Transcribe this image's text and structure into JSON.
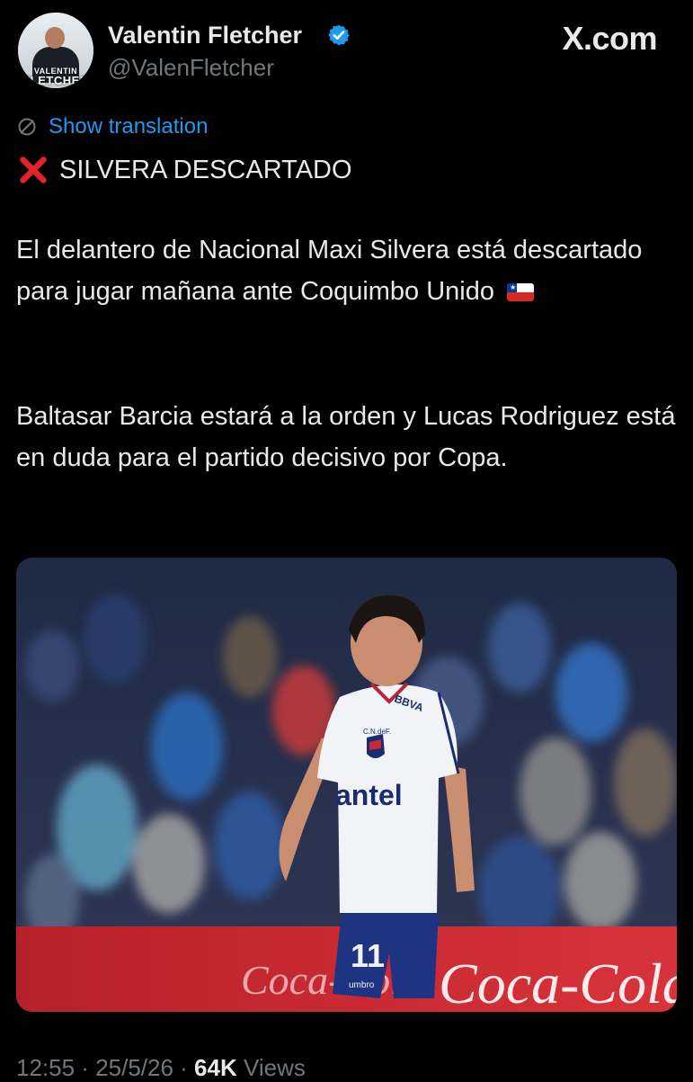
{
  "author": {
    "name": "Valentin Fletcher",
    "handle": "@ValenFletcher",
    "avatar_text_1": "VALENTIN",
    "avatar_text_2": "FLETCHER",
    "verified_icon": "verified-badge-icon"
  },
  "platform_label": "X.com",
  "translation_label": "Show translation",
  "tweet": {
    "title": "SILVERA DESCARTADO",
    "paragraph1": "El delantero de Nacional Maxi Silvera está descartado para jugar mañana ante Coquimbo Unido",
    "paragraph2": "Baltasar Barcia estará a la orden y Lucas Rodriguez está en duda para el partido decisivo por Copa."
  },
  "media": {
    "jersey_sponsor": "antel",
    "jersey_badge": "C.N.deF.",
    "jersey_brand": "BBVA",
    "shorts_number": "11",
    "shorts_brand": "umbro",
    "ad_text": "Coca-Cola",
    "ad_text_2": "Coca-Cola"
  },
  "meta": {
    "time": "12:55",
    "sep1": " · ",
    "date": "25/5/26",
    "sep2": " · ",
    "views_count": "64K",
    "views_label": " Views"
  },
  "colors": {
    "background": "#000000",
    "text": "#e7e9ea",
    "secondary": "#71767b",
    "link": "#1d9bf0",
    "verified": "#1d9bf0",
    "x_mark": "#e0242a"
  }
}
